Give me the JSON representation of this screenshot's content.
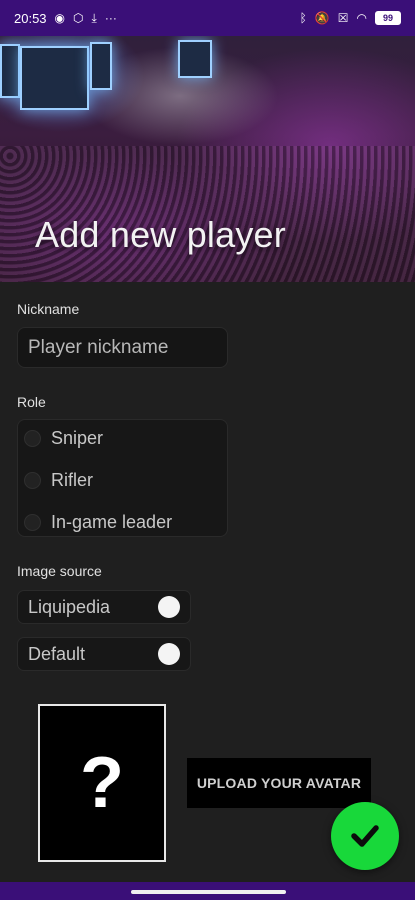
{
  "status": {
    "time": "20:53",
    "battery": "99",
    "left_icons": [
      "messenger-icon",
      "settings-cog-icon",
      "download-icon",
      "more-icon"
    ],
    "right_icons": [
      "bluetooth-icon",
      "mute-icon",
      "close-box-icon",
      "wifi-icon",
      "battery-icon"
    ]
  },
  "hero": {
    "title": "Add new player"
  },
  "form": {
    "nickname_label": "Nickname",
    "nickname_placeholder": "Player nickname",
    "role_label": "Role",
    "roles": [
      "Sniper",
      "Rifler",
      "In-game leader"
    ],
    "image_source_label": "Image source",
    "image_sources": [
      {
        "label": "Liquipedia",
        "on": false
      },
      {
        "label": "Default",
        "on": false
      }
    ]
  },
  "avatar": {
    "placeholder": "?"
  },
  "upload_button": "UPLOAD YOUR AVATAR",
  "fab": {
    "icon": "check-icon",
    "color": "#18d83a"
  },
  "colors": {
    "system_bars": "#3a0f78",
    "background": "#1f1f1f"
  }
}
